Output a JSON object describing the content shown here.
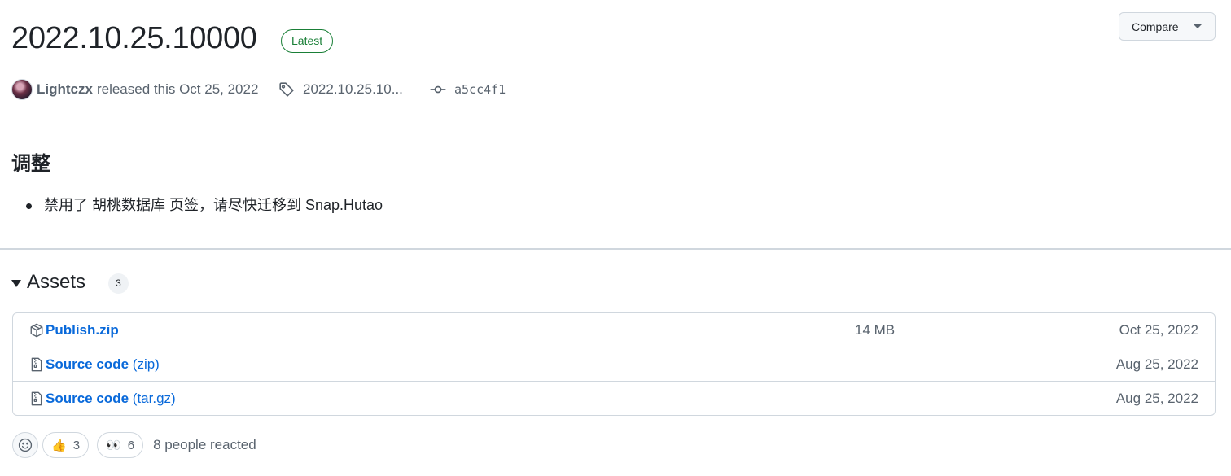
{
  "release": {
    "title": "2022.10.25.10000",
    "badge": "Latest",
    "compare_label": "Compare"
  },
  "meta": {
    "author": "Lightczx",
    "released_text": "released this Oct 25, 2022",
    "tag": "2022.10.25.10...",
    "commit": "a5cc4f1"
  },
  "notes": {
    "heading": "调整",
    "items": [
      "禁用了 胡桃数据库 页签，请尽快迁移到 Snap.Hutao"
    ]
  },
  "assets": {
    "title": "Assets",
    "count": "3",
    "rows": [
      {
        "name": "Publish.zip",
        "ext": "",
        "size": "14 MB",
        "date": "Oct 25, 2022",
        "icon": "package-icon"
      },
      {
        "name": "Source code",
        "ext": "(zip)",
        "size": "",
        "date": "Aug 25, 2022",
        "icon": "file-zip-icon"
      },
      {
        "name": "Source code",
        "ext": "(tar.gz)",
        "size": "",
        "date": "Aug 25, 2022",
        "icon": "file-zip-icon"
      }
    ]
  },
  "reactions": {
    "items": [
      {
        "emoji": "👍",
        "count": "3"
      },
      {
        "emoji": "👀",
        "count": "6"
      }
    ],
    "summary": "8 people reacted"
  },
  "colors": {
    "accent": "#0969da",
    "latest": "#1a7f37",
    "muted": "#59636e",
    "border": "#d0d7de"
  }
}
